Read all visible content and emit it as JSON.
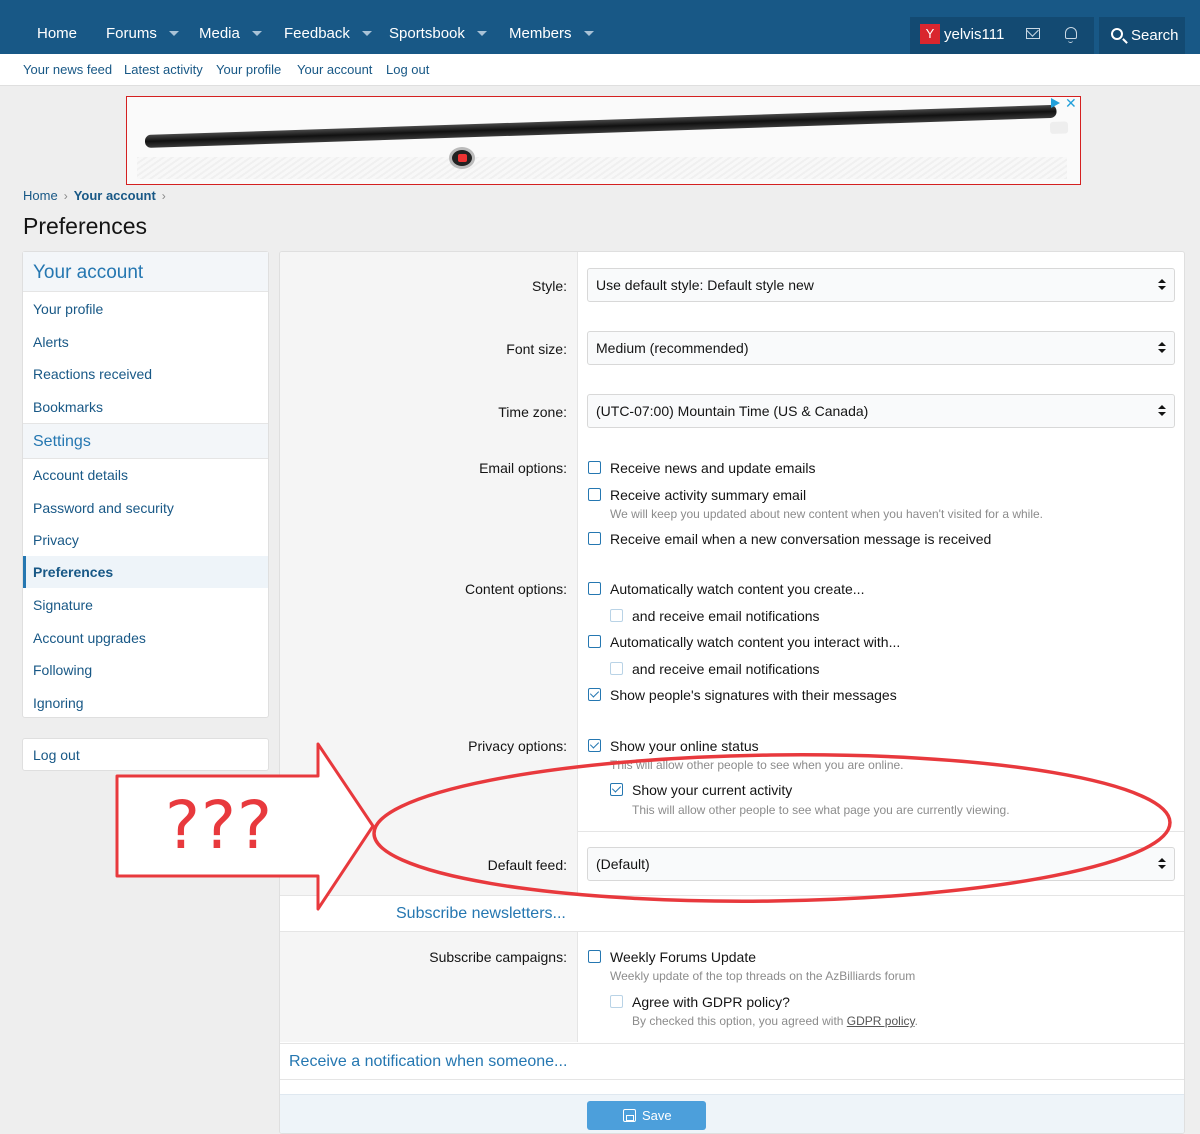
{
  "topnav": {
    "items": [
      "Home",
      "Forums",
      "Media",
      "Feedback",
      "Sportsbook",
      "Members"
    ],
    "avatar_letter": "Y",
    "username": "yelvis111",
    "search_label": "Search"
  },
  "subnav": {
    "items": [
      "Your news feed",
      "Latest activity",
      "Your profile",
      "Your account",
      "Log out"
    ]
  },
  "breadcrumb": {
    "home": "Home",
    "current": "Your account",
    "sep": "›"
  },
  "page_title": "Preferences",
  "sidebar": {
    "account_heading": "Your account",
    "account_items": [
      "Your profile",
      "Alerts",
      "Reactions received",
      "Bookmarks"
    ],
    "settings_heading": "Settings",
    "settings_items": [
      "Account details",
      "Password and security",
      "Privacy",
      "Preferences",
      "Signature",
      "Account upgrades",
      "Following",
      "Ignoring"
    ],
    "active_item": "Preferences",
    "logout": "Log out"
  },
  "form": {
    "style": {
      "label": "Style:",
      "value": "Use default style: Default style new"
    },
    "font_size": {
      "label": "Font size:",
      "value": "Medium (recommended)"
    },
    "time_zone": {
      "label": "Time zone:",
      "value": "(UTC-07:00) Mountain Time (US & Canada)"
    },
    "email_options": {
      "label": "Email options:",
      "news": "Receive news and update emails",
      "summary": "Receive activity summary email",
      "summary_hint": "We will keep you updated about new content when you haven't visited for a while.",
      "conversation": "Receive email when a new conversation message is received"
    },
    "content_options": {
      "label": "Content options:",
      "watch_create": "Automatically watch content you create...",
      "watch_create_email": "and receive email notifications",
      "watch_interact": "Automatically watch content you interact with...",
      "watch_interact_email": "and receive email notifications",
      "signatures": "Show people's signatures with their messages"
    },
    "privacy_options": {
      "label": "Privacy options:",
      "online": "Show your online status",
      "online_hint": "This will allow other people to see when you are online.",
      "activity": "Show your current activity",
      "activity_hint": "This will allow other people to see what page you are currently viewing."
    },
    "default_feed": {
      "label": "Default feed:",
      "value": "(Default)"
    },
    "subscribe_newsletters": "Subscribe newsletters...",
    "campaigns": {
      "label": "Subscribe campaigns:",
      "weekly": "Weekly Forums Update",
      "weekly_hint": "Weekly update of the top threads on the AzBilliards forum",
      "gdpr": "Agree with GDPR policy?",
      "gdpr_hint_prefix": "By checked this option, you agreed with ",
      "gdpr_link": "GDPR policy",
      "gdpr_hint_suffix": "."
    },
    "notification_link": "Receive a notification when someone...",
    "save_label": "Save"
  },
  "annotation": {
    "text": "???",
    "color": "#e8393d"
  },
  "colors": {
    "header": "#185886",
    "link": "#2577b1",
    "save": "#4c9fdb"
  }
}
